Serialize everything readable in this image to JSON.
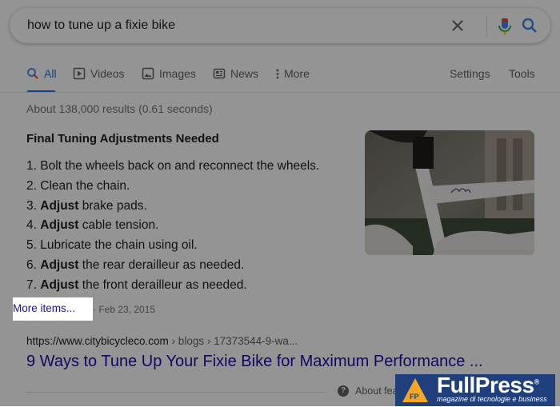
{
  "search": {
    "query": "how to tune up a fixie bike",
    "icons": [
      "clear-icon",
      "mic-icon",
      "search-icon"
    ]
  },
  "tabs": {
    "all": "All",
    "videos": "Videos",
    "images": "Images",
    "news": "News",
    "more": "More",
    "settings": "Settings",
    "tools": "Tools",
    "active_color": "#1a73e8"
  },
  "stats": "About 138,000 results (0.61 seconds)",
  "snippet": {
    "title": "Final Tuning Adjustments Needed",
    "steps": [
      {
        "num": "1.",
        "bold": "",
        "text": "Bolt the wheels back on and reconnect the wheels."
      },
      {
        "num": "2.",
        "bold": "",
        "text": "Clean the chain."
      },
      {
        "num": "3.",
        "bold": "Adjust",
        "text": " brake pads."
      },
      {
        "num": "4.",
        "bold": "Adjust",
        "text": " cable tension."
      },
      {
        "num": "5.",
        "bold": "",
        "text": "Lubricate the chain using oil."
      },
      {
        "num": "6.",
        "bold": "Adjust",
        "text": " the rear derailleur as needed."
      },
      {
        "num": "7.",
        "bold": "Adjust",
        "text": " the front derailleur as needed."
      }
    ],
    "more_items": "More items...",
    "date": "Feb 23, 2015"
  },
  "result": {
    "url_host": "https://www.citybicycleco.com",
    "url_path": " › blogs › 17373544-9-wa...",
    "title": "9 Ways to Tune Up Your Fixie Bike for Maximum Performance ...",
    "link_color": "#1a0dab"
  },
  "footer": {
    "about": "About fea"
  },
  "watermark": {
    "name": "FullPress",
    "registered": "®",
    "tagline": "magazine di tecnologie e business",
    "mark": "FP"
  }
}
